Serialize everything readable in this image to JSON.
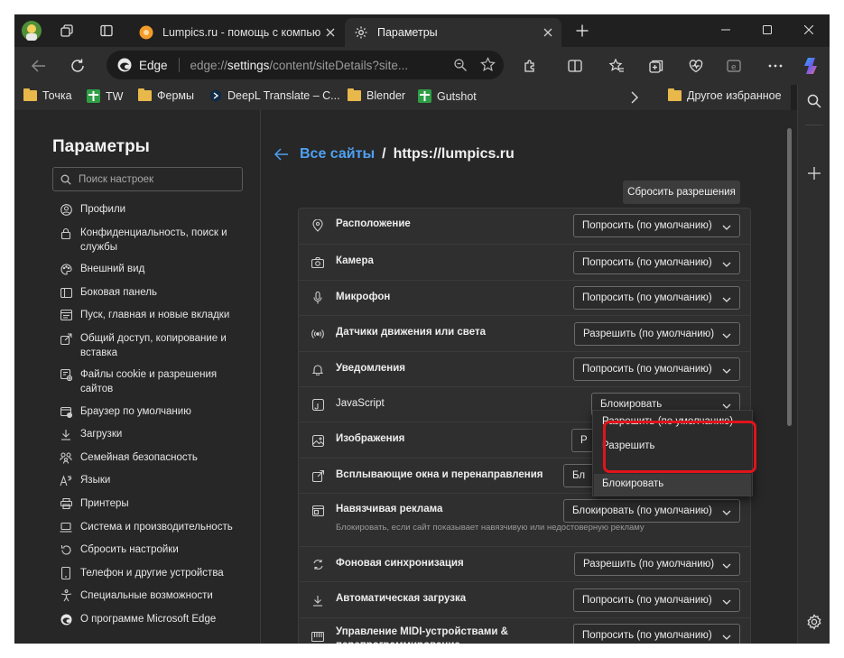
{
  "tabs": [
    {
      "title": "Lumpics.ru - помощь с компьюте"
    },
    {
      "title": "Параметры"
    }
  ],
  "address": {
    "brand": "Edge",
    "prefix": "edge://",
    "bold": "settings",
    "rest": "/content/siteDetails?site..."
  },
  "favorites": [
    {
      "label": "Точка",
      "icon": "folder"
    },
    {
      "label": "TW",
      "icon": "green-bookmark"
    },
    {
      "label": "Фермы",
      "icon": "folder"
    },
    {
      "label": "DeepL Translate – С...",
      "icon": "deepl"
    },
    {
      "label": "Blender",
      "icon": "folder"
    },
    {
      "label": "Gutshot",
      "icon": "green-bookmark"
    }
  ],
  "favorites_other": "Другое избранное",
  "settings": {
    "title": "Параметры",
    "search_placeholder": "Поиск настроек",
    "nav": [
      {
        "label": "Профили"
      },
      {
        "label": "Конфиденциальность, поиск и службы"
      },
      {
        "label": "Внешний вид"
      },
      {
        "label": "Боковая панель"
      },
      {
        "label": "Пуск, главная и новые вкладки"
      },
      {
        "label": "Общий доступ, копирование и вставка"
      },
      {
        "label": "Файлы cookie и разрешения сайтов"
      },
      {
        "label": "Браузер по умолчанию"
      },
      {
        "label": "Загрузки"
      },
      {
        "label": "Семейная безопасность"
      },
      {
        "label": "Языки"
      },
      {
        "label": "Принтеры"
      },
      {
        "label": "Система и производительность"
      },
      {
        "label": "Сбросить настройки"
      },
      {
        "label": "Телефон и другие устройства"
      },
      {
        "label": "Специальные возможности"
      },
      {
        "label": "О программе Microsoft Edge"
      }
    ]
  },
  "breadcrumb": {
    "link": "Все сайты",
    "sep": "/",
    "current": "https://lumpics.ru"
  },
  "reset_button": "Сбросить разрешения",
  "permissions": [
    {
      "label": "Расположение",
      "value": "Попросить (по умолчанию)"
    },
    {
      "label": "Камера",
      "value": "Попросить (по умолчанию)"
    },
    {
      "label": "Микрофон",
      "value": "Попросить (по умолчанию)"
    },
    {
      "label": "Датчики движения или света",
      "value": "Разрешить (по умолчанию)"
    },
    {
      "label": "Уведомления",
      "value": "Попросить (по умолчанию)"
    },
    {
      "label": "JavaScript",
      "value": "Блокировать"
    },
    {
      "label": "Изображения",
      "value": "Р"
    },
    {
      "label": "Всплывающие окна и перенаправления",
      "value": "Бл"
    },
    {
      "label": "Навязчивая реклама",
      "value": "Блокировать (по умолчанию)",
      "sub": "Блокировать, если сайт показывает навязчивую или недостоверную рекламу"
    },
    {
      "label": "Фоновая синхронизация",
      "value": "Разрешить (по умолчанию)"
    },
    {
      "label": "Автоматическая загрузка",
      "value": "Попросить (по умолчанию)"
    },
    {
      "label": "Управление MIDI-устройствами & перепрограммирование",
      "value": "Попросить (по умолчанию)"
    }
  ],
  "js_dropdown_options": [
    "Разрешить (по умолчанию)",
    "Разрешить",
    "Блокировать"
  ],
  "colors": {
    "accent": "#4ea1f2",
    "highlight": "#e0141b",
    "bg": "#272727"
  }
}
